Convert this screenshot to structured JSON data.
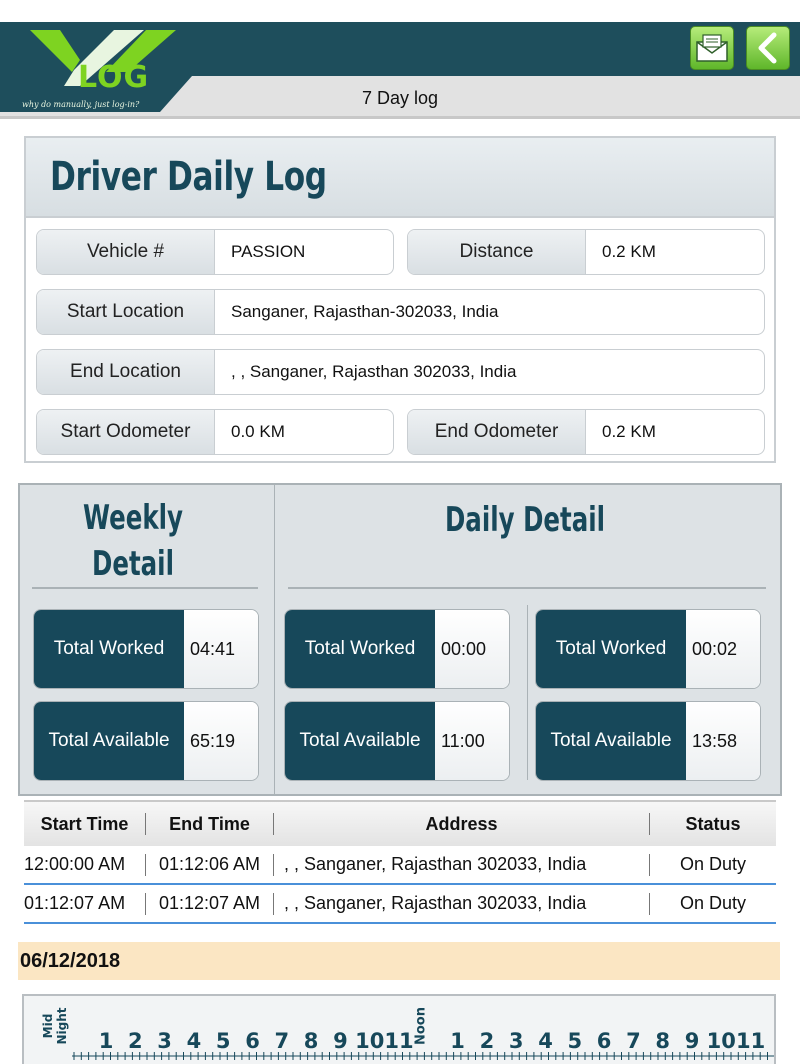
{
  "header": {
    "logo_text": "LOG",
    "logo_tagline": "why do manually, just log-in?",
    "page_title": "7 Day log",
    "mail_icon": "mail-icon",
    "back_icon": "chevron-left-icon",
    "accent_color": "#1e4e5c",
    "button_color": "#7ed321"
  },
  "log_card": {
    "title": "Driver Daily Log",
    "vehicle_label": "Vehicle #",
    "vehicle_value": "PASSION",
    "distance_label": "Distance",
    "distance_value": "0.2 KM",
    "start_location_label": "Start Location",
    "start_location_value": "Sanganer, Rajasthan-302033, India",
    "end_location_label": "End Location",
    "end_location_value": ", , Sanganer, Rajasthan 302033, India",
    "start_odometer_label": "Start Odometer",
    "start_odometer_value": "0.0 KM",
    "end_odometer_label": "End Odometer",
    "end_odometer_value": "0.2 KM"
  },
  "weekly": {
    "title_line1": "Weekly",
    "title_line2": "Detail",
    "worked_label": "Total Worked",
    "worked_value": "04:41",
    "available_label": "Total Available",
    "available_value": "65:19"
  },
  "daily": {
    "title": "Daily Detail",
    "columns": [
      {
        "worked_label": "Total Worked",
        "worked_value": "00:00",
        "available_label": "Total Available",
        "available_value": "11:00"
      },
      {
        "worked_label": "Total Worked",
        "worked_value": "00:02",
        "available_label": "Total Available",
        "available_value": "13:58"
      }
    ]
  },
  "table": {
    "headers": [
      "Start Time",
      "End Time",
      "Address",
      "Status"
    ],
    "rows": [
      [
        "12:00:00 AM",
        "01:12:06 AM",
        ", , Sanganer, Rajasthan 302033, India",
        "On Duty"
      ],
      [
        "01:12:07 AM",
        "01:12:07 AM",
        ", , Sanganer, Rajasthan 302033, India",
        "On Duty"
      ]
    ]
  },
  "date": "06/12/2018",
  "graph": {
    "midnight_label": "Mid Night",
    "noon_label": "Noon",
    "hour_labels": [
      "1",
      "2",
      "3",
      "4",
      "5",
      "6",
      "7",
      "8",
      "9",
      "10",
      "11",
      "1",
      "2",
      "3",
      "4",
      "5",
      "6",
      "7",
      "8",
      "9",
      "10",
      "11"
    ]
  }
}
